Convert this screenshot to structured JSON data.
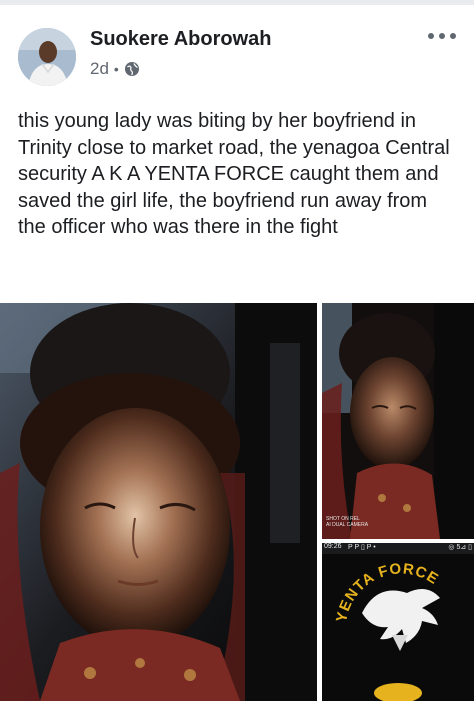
{
  "post": {
    "author": "Suokere Aborowah",
    "time": "2d",
    "separator": "•",
    "privacy_icon": "globe-icon",
    "more_icon": "more-dots-icon",
    "text": "this young lady was biting by her boyfriend in Trinity close to market road, the yenagoa Central security A K A YENTA FORCE caught them and saved the girl life, the boyfriend run away from the officer who was there in the fight"
  },
  "photos": {
    "main": {
      "subject": "young woman with eyes closed"
    },
    "top_right": {
      "subject": "young woman with eyes closed",
      "watermark_line1": "SHOT ON REL",
      "watermark_line2": "AI DUAL CAMERA"
    },
    "bottom_right": {
      "status_time": "09:26",
      "status_icons": "P P ▯ P •",
      "status_right": "◎ 5⊿ ▯",
      "logo_text": "YENTA FORCE"
    }
  },
  "colors": {
    "author": "#1c1e21",
    "meta": "#606770",
    "logo_gold": "#e6b21e"
  }
}
